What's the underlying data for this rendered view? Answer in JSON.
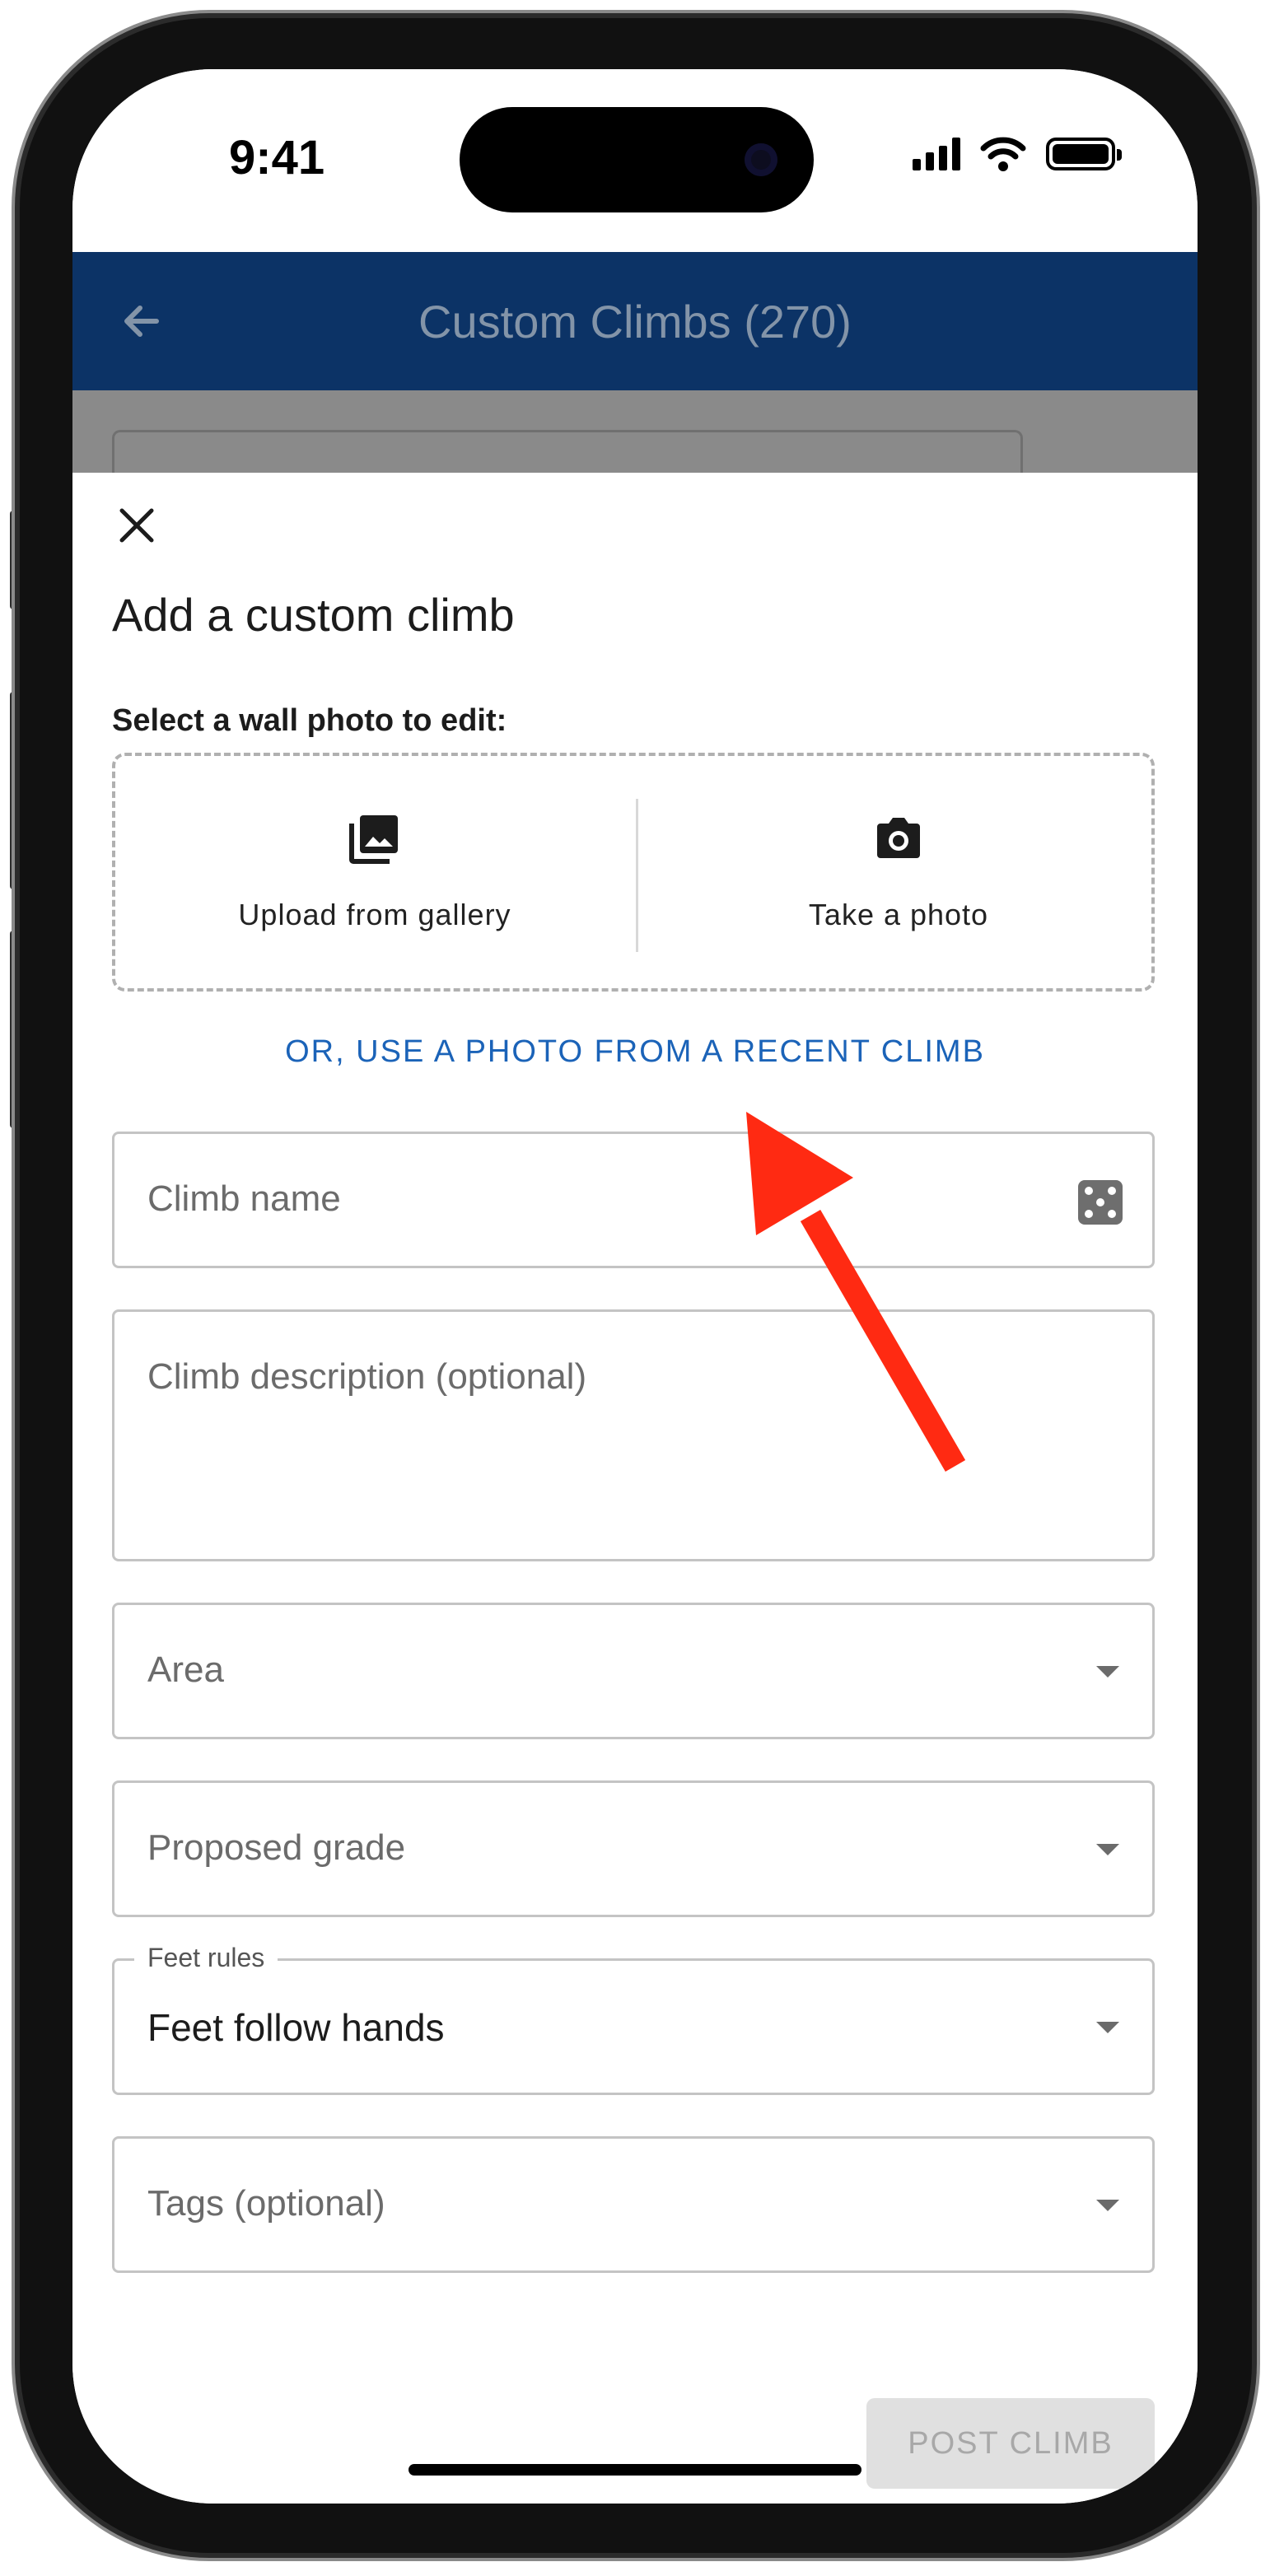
{
  "status_bar": {
    "time": "9:41"
  },
  "app_bar": {
    "title": "Custom Climbs (270)"
  },
  "sheet": {
    "title": "Add a custom climb",
    "photo_label": "Select a wall photo to edit:",
    "upload_label": "Upload from gallery",
    "camera_label": "Take a photo",
    "recent_link": "OR, USE A PHOTO FROM A RECENT CLIMB"
  },
  "form": {
    "name_placeholder": "Climb name",
    "description_placeholder": "Climb description (optional)",
    "area_placeholder": "Area",
    "grade_placeholder": "Proposed grade",
    "feet_label": "Feet rules",
    "feet_value": "Feet follow hands",
    "tags_placeholder": "Tags (optional)",
    "post_label": "POST CLIMB"
  },
  "colors": {
    "app_bar": "#0c3366",
    "link": "#1b63b8",
    "annotation_arrow": "#ff2a12"
  },
  "icons": [
    "back-arrow-icon",
    "close-icon",
    "gallery-icon",
    "camera-icon",
    "dice-icon",
    "dropdown-caret-icon"
  ]
}
